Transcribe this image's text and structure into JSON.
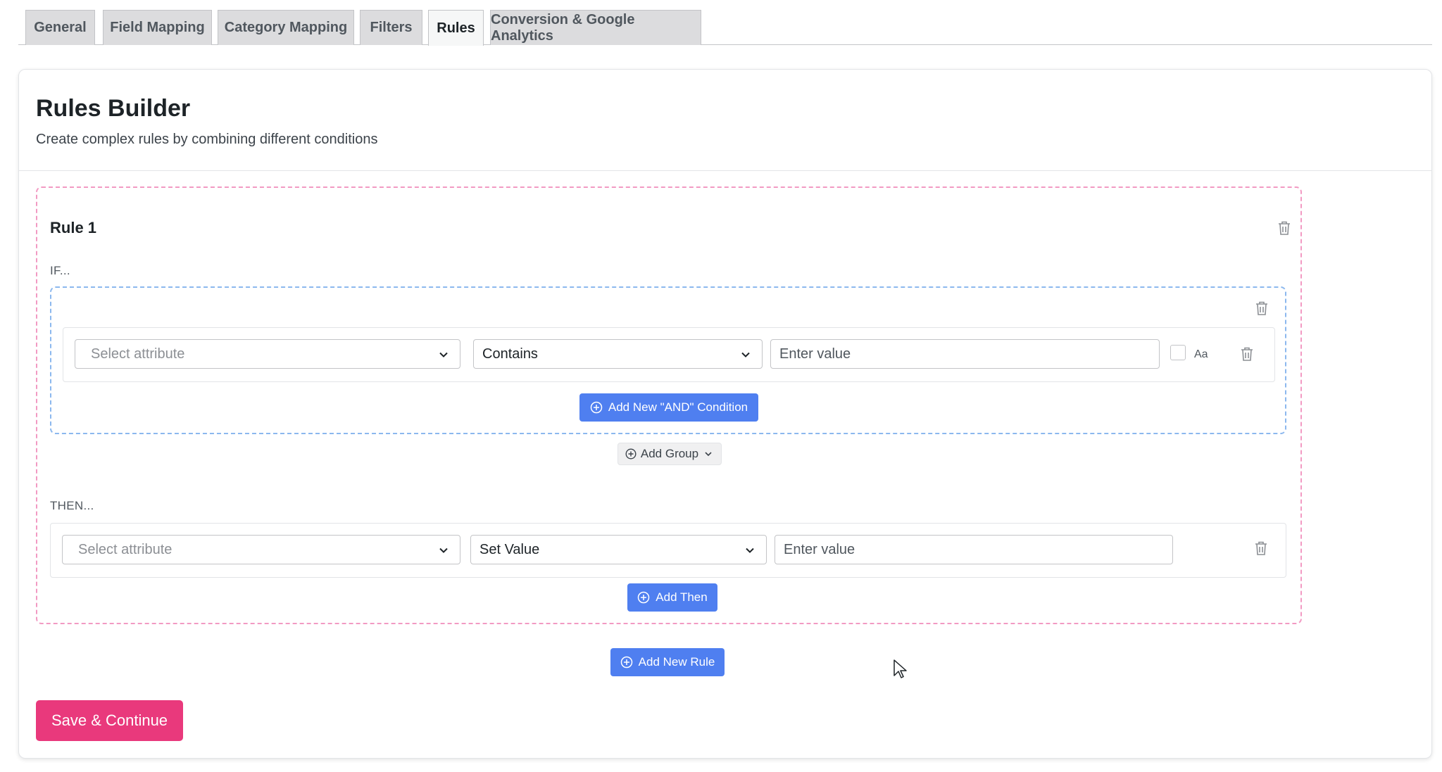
{
  "tabs": [
    {
      "label": "General"
    },
    {
      "label": "Field Mapping"
    },
    {
      "label": "Category Mapping"
    },
    {
      "label": "Filters"
    },
    {
      "label": "Rules"
    },
    {
      "label": "Conversion & Google Analytics"
    }
  ],
  "active_tab": "Rules",
  "page": {
    "title": "Rules Builder",
    "subtitle": "Create complex rules by combining different conditions"
  },
  "rule": {
    "title": "Rule 1",
    "if_label": "IF...",
    "then_label": "THEN...",
    "condition": {
      "attribute_placeholder": "Select attribute",
      "operator": "Contains",
      "value_placeholder": "Enter value",
      "case_label": "Aa",
      "case_sensitive": false
    },
    "add_and_label": "Add New \"AND\" Condition",
    "add_group_label": "Add Group",
    "action": {
      "attribute_placeholder": "Select attribute",
      "operation": "Set Value",
      "value_placeholder": "Enter value"
    },
    "add_then_label": "Add Then"
  },
  "add_rule_label": "Add New Rule",
  "save_label": "Save & Continue",
  "colors": {
    "accent_blue": "#4f7ff0",
    "save_pink": "#e9397c",
    "rule_border": "#f29ac3",
    "group_border": "#8cb8ee"
  }
}
